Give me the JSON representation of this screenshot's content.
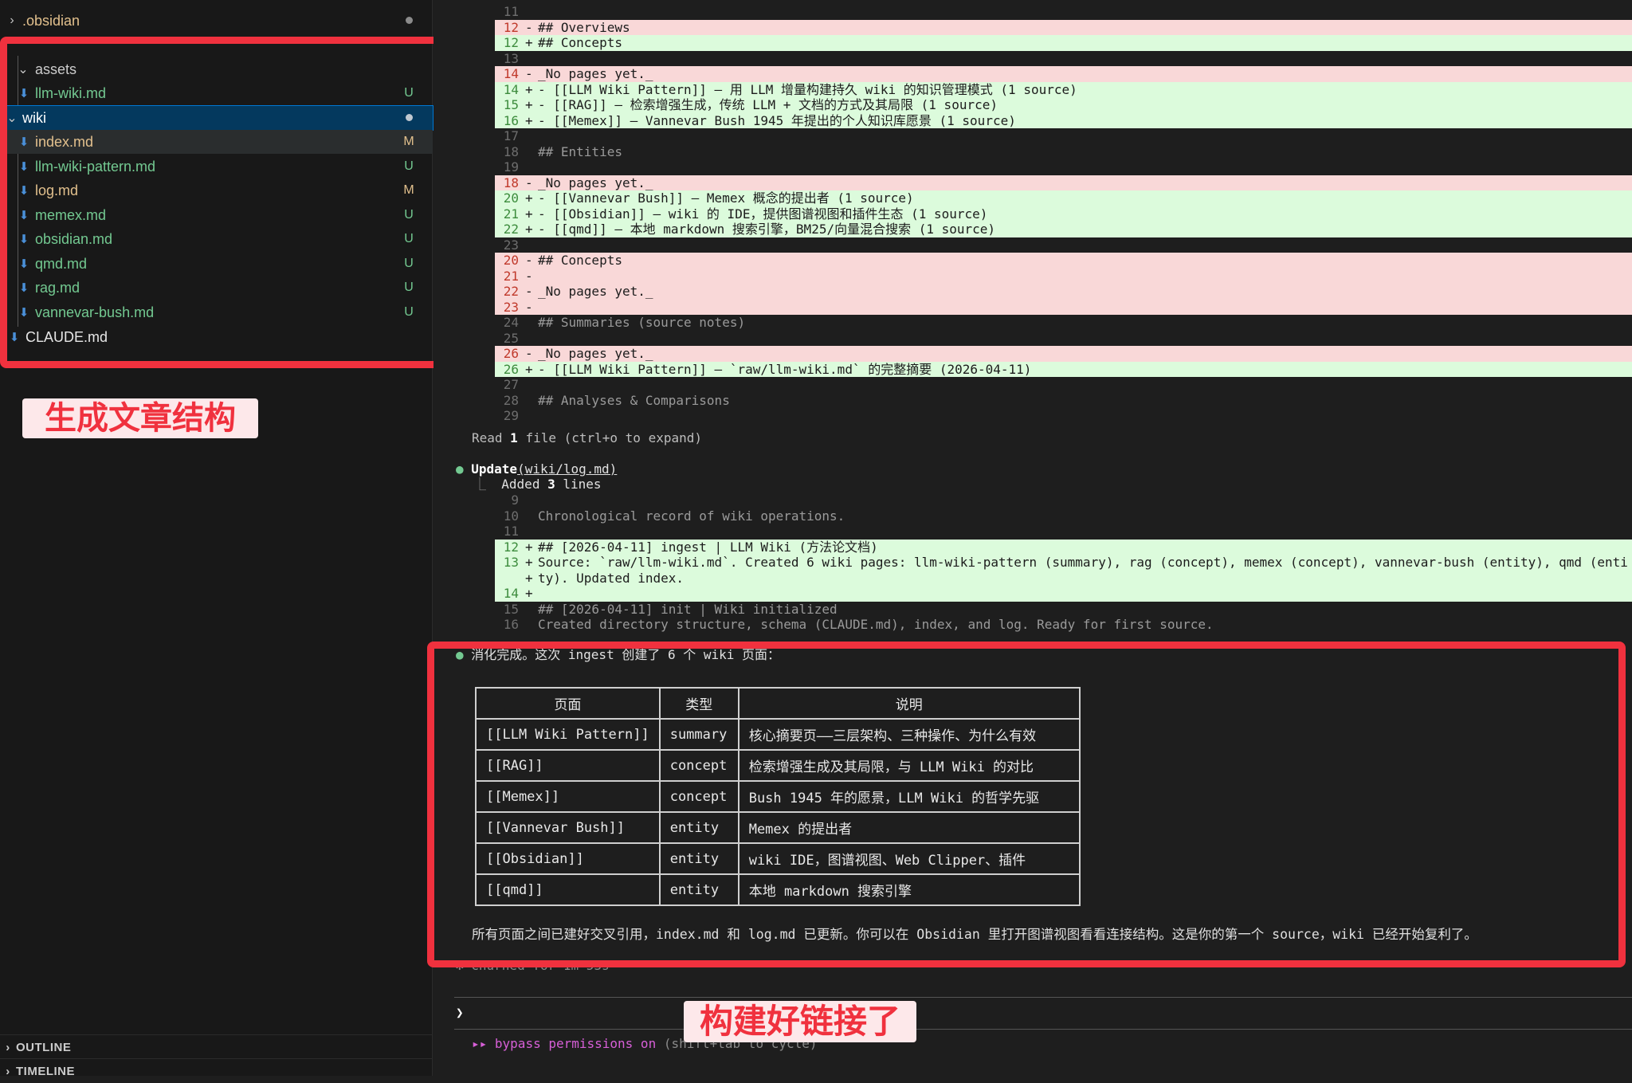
{
  "sidebar": {
    "items": [
      {
        "label": ".obsidian",
        "status": "",
        "dot": true
      },
      {
        "label": "assets",
        "status": ""
      },
      {
        "label": "llm-wiki.md",
        "status": "U"
      },
      {
        "label": "wiki",
        "status": "",
        "dot": true
      },
      {
        "label": "index.md",
        "status": "M"
      },
      {
        "label": "llm-wiki-pattern.md",
        "status": "U"
      },
      {
        "label": "log.md",
        "status": "M"
      },
      {
        "label": "memex.md",
        "status": "U"
      },
      {
        "label": "obsidian.md",
        "status": "U"
      },
      {
        "label": "qmd.md",
        "status": "U"
      },
      {
        "label": "rag.md",
        "status": "U"
      },
      {
        "label": "vannevar-bush.md",
        "status": "U"
      },
      {
        "label": "CLAUDE.md",
        "status": ""
      }
    ],
    "annotation": "生成文章结构",
    "outline": "OUTLINE",
    "timeline": "TIMELINE"
  },
  "diff1": [
    {
      "kind": "ctx",
      "n": "11",
      "s": "",
      "text": ""
    },
    {
      "kind": "del",
      "n": "12",
      "s": "-",
      "text": "## Overviews"
    },
    {
      "kind": "add",
      "n": "12",
      "s": "+",
      "text": "## Concepts"
    },
    {
      "kind": "ctx",
      "n": "13",
      "s": "",
      "text": ""
    },
    {
      "kind": "del",
      "n": "14",
      "s": "-",
      "text": "_No pages yet._"
    },
    {
      "kind": "add",
      "n": "14",
      "s": "+",
      "text": "- [[LLM Wiki Pattern]] — 用 LLM 增量构建持久 wiki 的知识管理模式 (1 source)"
    },
    {
      "kind": "add",
      "n": "15",
      "s": "+",
      "text": "- [[RAG]] — 检索增强生成，传统 LLM + 文档的方式及其局限 (1 source)"
    },
    {
      "kind": "add",
      "n": "16",
      "s": "+",
      "text": "- [[Memex]] — Vannevar Bush 1945 年提出的个人知识库愿景 (1 source)"
    },
    {
      "kind": "ctx",
      "n": "17",
      "s": "",
      "text": ""
    },
    {
      "kind": "ctx",
      "n": "18",
      "s": "",
      "text": "## Entities"
    },
    {
      "kind": "ctx",
      "n": "19",
      "s": "",
      "text": ""
    },
    {
      "kind": "del",
      "n": "18",
      "s": "-",
      "text": "_No pages yet._"
    },
    {
      "kind": "add",
      "n": "20",
      "s": "+",
      "text": "- [[Vannevar Bush]] — Memex 概念的提出者 (1 source)"
    },
    {
      "kind": "add",
      "n": "21",
      "s": "+",
      "text": "- [[Obsidian]] — wiki 的 IDE，提供图谱视图和插件生态 (1 source)"
    },
    {
      "kind": "add",
      "n": "22",
      "s": "+",
      "text": "- [[qmd]] — 本地 markdown 搜索引擎，BM25/向量混合搜索 (1 source)"
    },
    {
      "kind": "ctx",
      "n": "23",
      "s": "",
      "text": ""
    },
    {
      "kind": "del",
      "n": "20",
      "s": "-",
      "text": "## Concepts"
    },
    {
      "kind": "del",
      "n": "21",
      "s": "-",
      "text": ""
    },
    {
      "kind": "del",
      "n": "22",
      "s": "-",
      "text": "_No pages yet._"
    },
    {
      "kind": "del",
      "n": "23",
      "s": "-",
      "text": ""
    },
    {
      "kind": "ctx",
      "n": "24",
      "s": "",
      "text": "## Summaries (source notes)"
    },
    {
      "kind": "ctx",
      "n": "25",
      "s": "",
      "text": ""
    },
    {
      "kind": "del",
      "n": "26",
      "s": "-",
      "text": "_No pages yet._"
    },
    {
      "kind": "add",
      "n": "26",
      "s": "+",
      "text": "- [[LLM Wiki Pattern]] — `raw/llm-wiki.md` 的完整摘要 (2026-04-11)"
    },
    {
      "kind": "ctx",
      "n": "27",
      "s": "",
      "text": ""
    },
    {
      "kind": "ctx",
      "n": "28",
      "s": "",
      "text": "## Analyses & Comparisons"
    },
    {
      "kind": "ctx",
      "n": "29",
      "s": "",
      "text": ""
    }
  ],
  "read_line": {
    "prefix": "Read ",
    "count": "1",
    "suffix": " file (ctrl+o to expand)"
  },
  "update": {
    "tool": "Update",
    "arg": "(wiki/log.md)",
    "added_prefix": "Added ",
    "added_count": "3",
    "added_suffix": " lines"
  },
  "diff2": [
    {
      "kind": "ctx",
      "n": "9",
      "s": "",
      "text": ""
    },
    {
      "kind": "ctx",
      "n": "10",
      "s": "",
      "text": "Chronological record of wiki operations."
    },
    {
      "kind": "ctx",
      "n": "11",
      "s": "",
      "text": ""
    },
    {
      "kind": "add",
      "n": "12",
      "s": "+",
      "text": "## [2026-04-11] ingest | LLM Wiki (方法论文档)"
    },
    {
      "kind": "add",
      "n": "13",
      "s": "+",
      "text": "Source: `raw/llm-wiki.md`. Created 6 wiki pages: llm-wiki-pattern (summary), rag (concept), memex (concept), vannevar-bush (entity), qmd (enti"
    },
    {
      "kind": "add",
      "n": "",
      "s": "+",
      "text": "ty). Updated index."
    },
    {
      "kind": "add",
      "n": "14",
      "s": "+",
      "text": ""
    },
    {
      "kind": "ctx",
      "n": "15",
      "s": "",
      "text": "## [2026-04-11] init | Wiki initialized"
    },
    {
      "kind": "ctx",
      "n": "16",
      "s": "",
      "text": "Created directory structure, schema (CLAUDE.md), index, and log. Ready for first source."
    }
  ],
  "summary_heading": "消化完成。这次 ingest 创建了 6 个 wiki 页面：",
  "table": {
    "headers": [
      "页面",
      "类型",
      "说明"
    ],
    "rows": [
      [
        "[[LLM Wiki Pattern]]",
        "summary",
        "核心摘要页——三层架构、三种操作、为什么有效"
      ],
      [
        "[[RAG]]",
        "concept",
        "检索增强生成及其局限，与 LLM Wiki 的对比"
      ],
      [
        "[[Memex]]",
        "concept",
        "Bush 1945 年的愿景，LLM Wiki 的哲学先驱"
      ],
      [
        "[[Vannevar Bush]]",
        "entity",
        "Memex 的提出者"
      ],
      [
        "[[Obsidian]]",
        "entity",
        "wiki IDE，图谱视图、Web Clipper、插件"
      ],
      [
        "[[qmd]]",
        "entity",
        "本地 markdown 搜索引擎"
      ]
    ]
  },
  "closing": "所有页面之间已建好交叉引用，index.md 和 log.md 已更新。你可以在 Obsidian 里打开图谱视图看看连接结构。这是你的第一个 source，wiki 已经开始复利了。",
  "churned": "✻ Churned for 1m 53s",
  "prompt_symbol": "❯",
  "bypass": {
    "arrows": "▸▸",
    "text": "bypass permissions on",
    "hint": "(shift+tab to cycle)"
  },
  "annotation_right": "构建好链接了",
  "colors": {
    "annotation": "#f0313e",
    "untracked": "#73c991",
    "modified": "#e2c08d",
    "selection": "#04395e"
  }
}
